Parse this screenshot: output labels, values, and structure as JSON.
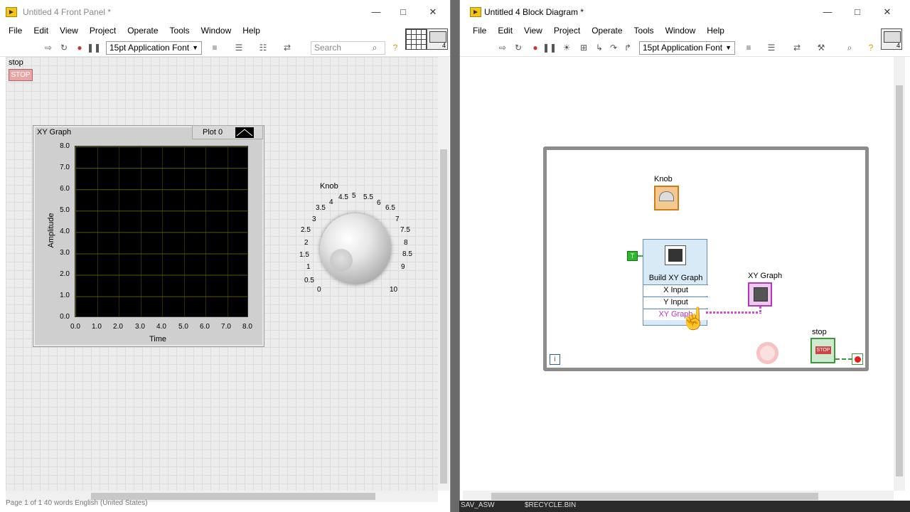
{
  "front_panel": {
    "title": "Untitled 4 Front Panel *",
    "menu": [
      "File",
      "Edit",
      "View",
      "Project",
      "Operate",
      "Tools",
      "Window",
      "Help"
    ],
    "font": "15pt Application Font",
    "search_placeholder": "Search",
    "stop_label": "stop",
    "stop_button": "STOP",
    "graph": {
      "label": "XY Graph",
      "legend": "Plot 0",
      "ylabel": "Amplitude",
      "xlabel": "Time",
      "yticks": [
        "8.0",
        "7.0",
        "6.0",
        "5.0",
        "4.0",
        "3.0",
        "2.0",
        "1.0",
        "0.0"
      ],
      "xticks": [
        "0.0",
        "1.0",
        "2.0",
        "3.0",
        "4.0",
        "5.0",
        "6.0",
        "7.0",
        "8.0"
      ]
    },
    "knob": {
      "label": "Knob",
      "ticks": [
        "0",
        "0.5",
        "1",
        "1.5",
        "2",
        "2.5",
        "3",
        "3.5",
        "4",
        "4.5",
        "5",
        "5.5",
        "6",
        "6.5",
        "7",
        "7.5",
        "8",
        "8.5",
        "9",
        "10"
      ]
    },
    "status": "Page 1 of 1    40 words    English (United States)"
  },
  "block_diagram": {
    "title": "Untitled 4 Block Diagram *",
    "menu": [
      "File",
      "Edit",
      "View",
      "Project",
      "Operate",
      "Tools",
      "Window",
      "Help"
    ],
    "font": "15pt Application Font",
    "knob_label": "Knob",
    "build_xy": {
      "title": "Build XY Graph",
      "inputs": [
        "X Input",
        "Y Input",
        "XY Graph"
      ]
    },
    "xy_graph_label": "XY Graph",
    "stop_label": "stop",
    "stop_text": "STOP",
    "iteration": "i",
    "true_const": "T",
    "taskbar": [
      "SAV_ASW",
      "$RECYCLE.BIN"
    ]
  },
  "colors": {
    "accent": "#d14fd1",
    "stop_red": "#e8a7a7",
    "graph_grid": "#5a5a00"
  }
}
